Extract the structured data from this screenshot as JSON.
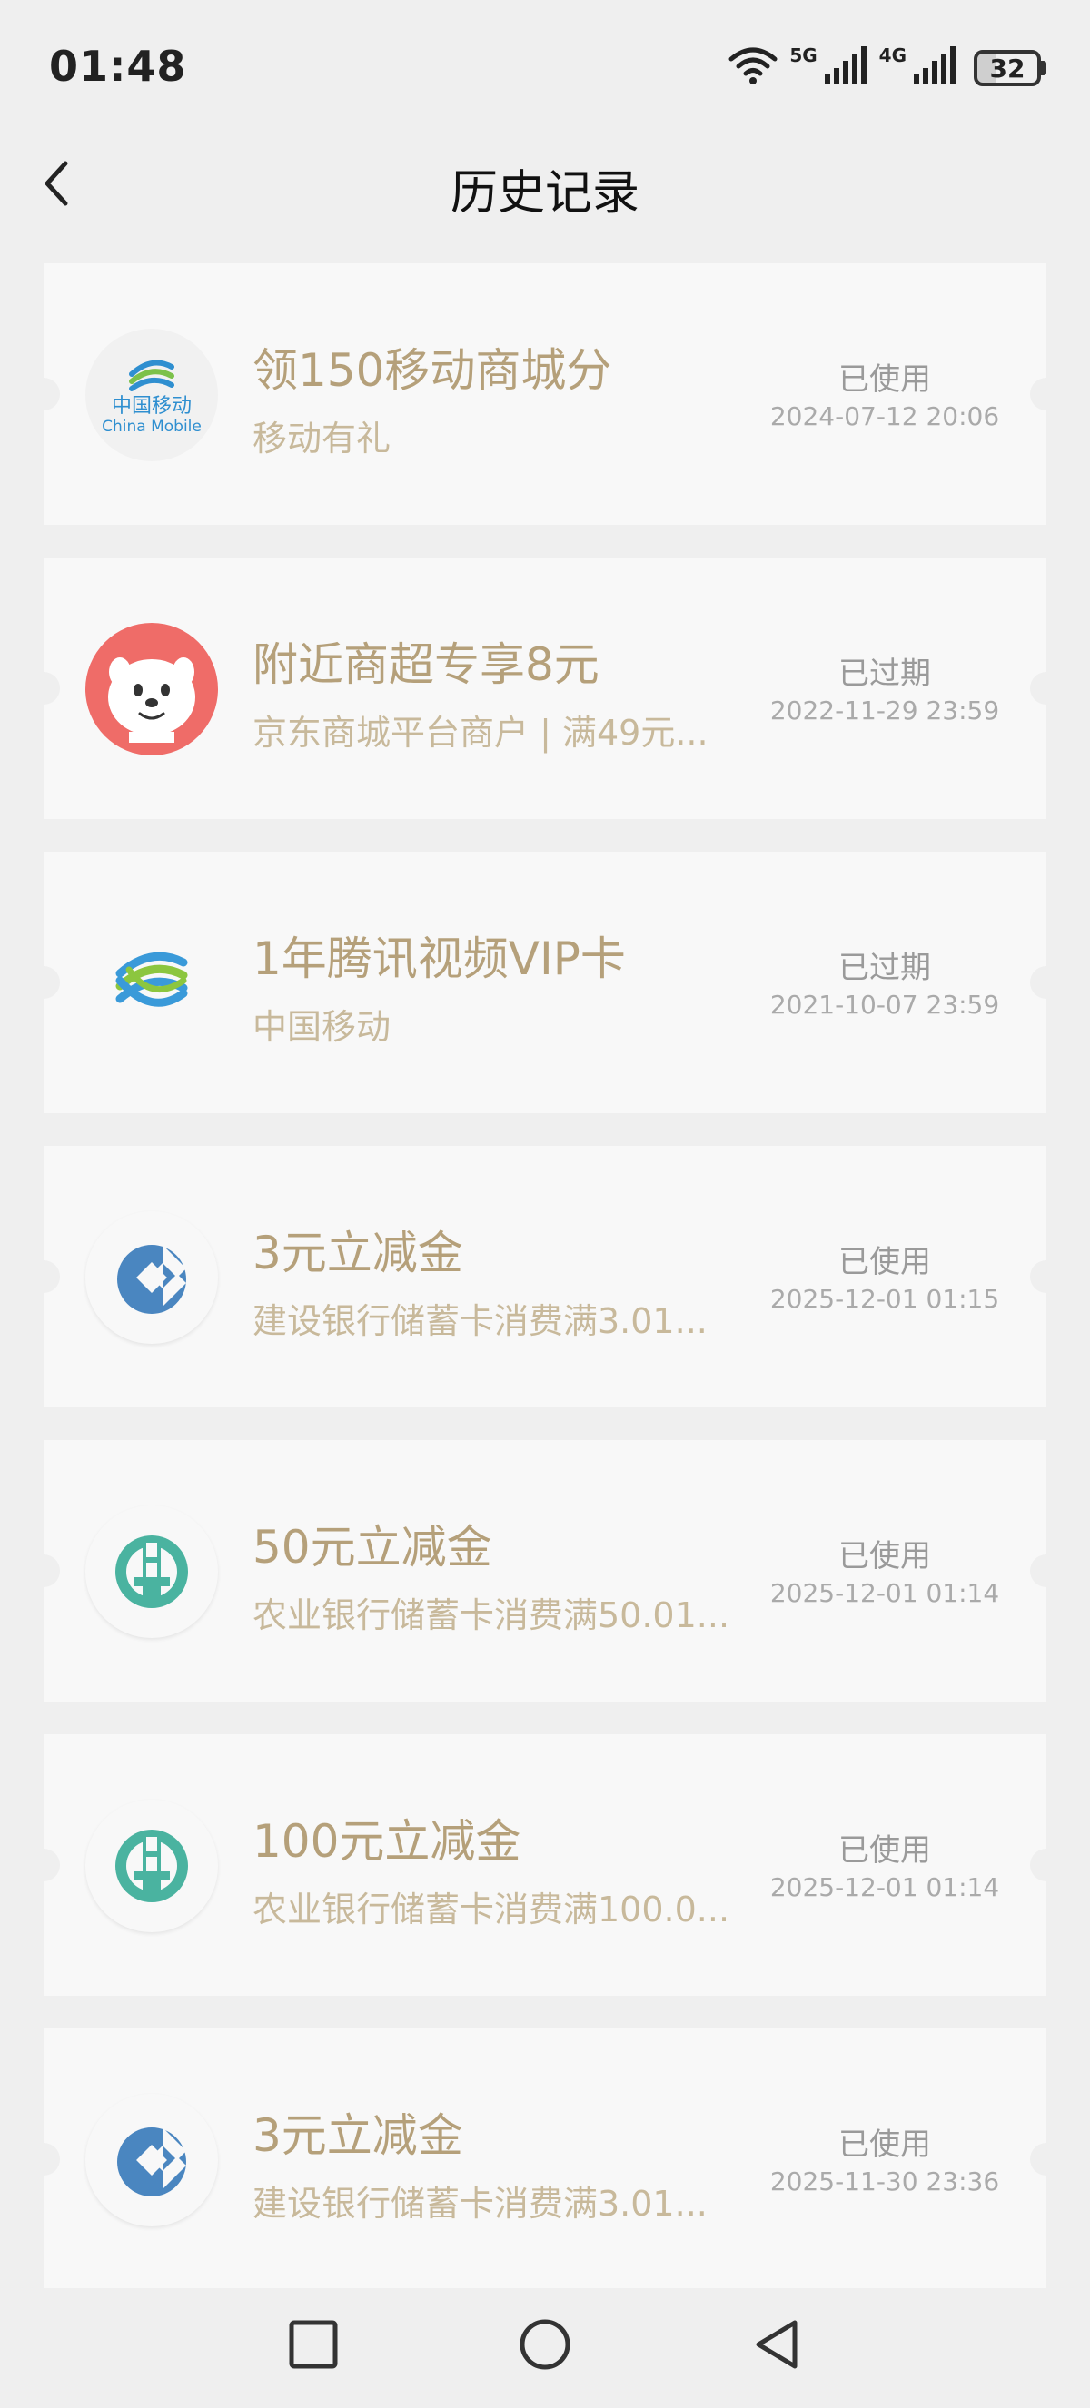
{
  "status_bar": {
    "time": "01:48",
    "network_1": "5G",
    "network_2": "4G",
    "battery": "32"
  },
  "header": {
    "title": "历史记录",
    "back_icon": "chevron-left-icon"
  },
  "records": [
    {
      "logo": "china-mobile-full-logo",
      "logo_text": "中国移动",
      "logo_subtext": "China Mobile",
      "title": "领150移动商城分",
      "subtitle": "移动有礼",
      "status": "已使用",
      "date": "2024-07-12 20:06"
    },
    {
      "logo": "jd-mascot-logo",
      "title": "附近商超专享8元",
      "subtitle": "京东商城平台商户 | 满49元...",
      "status": "已过期",
      "date": "2022-11-29 23:59"
    },
    {
      "logo": "china-mobile-logo",
      "title": "1年腾讯视频VIP卡",
      "subtitle": "中国移动",
      "status": "已过期",
      "date": "2021-10-07 23:59"
    },
    {
      "logo": "ccb-logo",
      "title": "3元立减金",
      "subtitle": "建设银行储蓄卡消费满3.01...",
      "status": "已使用",
      "date": "2025-12-01 01:15"
    },
    {
      "logo": "abc-logo",
      "title": "50元立减金",
      "subtitle": "农业银行储蓄卡消费满50.01...",
      "status": "已使用",
      "date": "2025-12-01 01:14"
    },
    {
      "logo": "abc-logo",
      "title": "100元立减金",
      "subtitle": "农业银行储蓄卡消费满100.0...",
      "status": "已使用",
      "date": "2025-12-01 01:14"
    },
    {
      "logo": "ccb-logo",
      "title": "3元立减金",
      "subtitle": "建设银行储蓄卡消费满3.01...",
      "status": "已使用",
      "date": "2025-11-30 23:36"
    }
  ],
  "colors": {
    "background": "#efefef",
    "card": "#f8f8f8",
    "title_gold": "#b5a07a",
    "subtitle_gold": "#c8b99b",
    "status_gray": "#9a9a9a"
  }
}
